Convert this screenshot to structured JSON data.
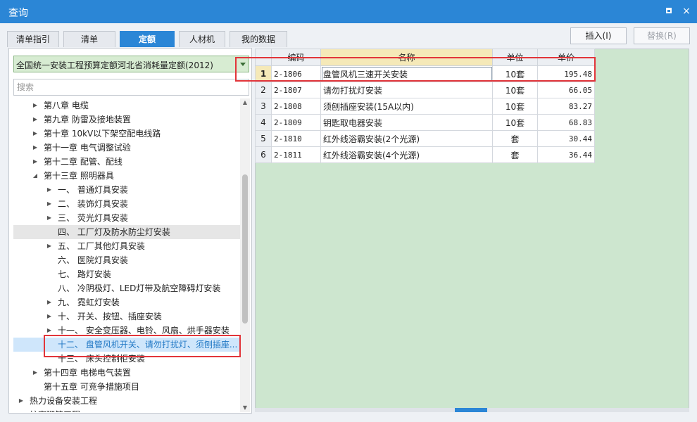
{
  "window": {
    "title": "查询",
    "maximize_label": "",
    "close_label": "×"
  },
  "tabs": [
    {
      "label": "清单指引",
      "active": false
    },
    {
      "label": "清单",
      "active": false
    },
    {
      "label": "定额",
      "active": true
    },
    {
      "label": "人材机",
      "active": false
    },
    {
      "label": "我的数据",
      "active": false
    }
  ],
  "toolbar": {
    "insert_label": "插入(I)",
    "replace_label": "替换(R)"
  },
  "quota_library": {
    "selected": "全国统一安装工程预算定额河北省消耗量定额(2012)"
  },
  "search": {
    "placeholder": "搜索",
    "value": ""
  },
  "tree": [
    {
      "label": "第八章 电缆",
      "toggle": "▶",
      "level": 1
    },
    {
      "label": "第九章 防雷及接地装置",
      "toggle": "▶",
      "level": 1
    },
    {
      "label": "第十章 10kV以下架空配电线路",
      "toggle": "▶",
      "level": 1
    },
    {
      "label": "第十一章 电气调整试验",
      "toggle": "▶",
      "level": 1
    },
    {
      "label": "第十二章 配管、配线",
      "toggle": "▶",
      "level": 1
    },
    {
      "label": "第十三章 照明器具",
      "toggle": "◢",
      "level": 1
    },
    {
      "label": "一、 普通灯具安装",
      "toggle": "▶",
      "level": 2
    },
    {
      "label": "二、 装饰灯具安装",
      "toggle": "▶",
      "level": 2
    },
    {
      "label": "三、 荧光灯具安装",
      "toggle": "▶",
      "level": 2
    },
    {
      "label": "四、 工厂灯及防水防尘灯安装",
      "toggle": "",
      "level": 2,
      "state": "hover"
    },
    {
      "label": "五、 工厂其他灯具安装",
      "toggle": "▶",
      "level": 2
    },
    {
      "label": "六、 医院灯具安装",
      "toggle": "",
      "level": 2
    },
    {
      "label": "七、 路灯安装",
      "toggle": "",
      "level": 2
    },
    {
      "label": "八、 冷阴极灯、LED灯带及航空障碍灯安装",
      "toggle": "",
      "level": 2
    },
    {
      "label": "九、 霓虹灯安装",
      "toggle": "▶",
      "level": 2
    },
    {
      "label": "十、 开关、按钮、插座安装",
      "toggle": "▶",
      "level": 2
    },
    {
      "label": "十一、 安全变压器、电铃、风扇、烘手器安装",
      "toggle": "▶",
      "level": 2
    },
    {
      "label": "十二、 盘管风机开关、请勿打扰灯、须刨插座...",
      "toggle": "",
      "level": 2,
      "state": "selected"
    },
    {
      "label": "十三、 床头控制柜安装",
      "toggle": "",
      "level": 2
    },
    {
      "label": "第十四章 电梯电气装置",
      "toggle": "▶",
      "level": 1
    },
    {
      "label": "第十五章 可竞争措施项目",
      "toggle": "",
      "level": 1
    },
    {
      "label": "热力设备安装工程",
      "toggle": "▶",
      "level": 0
    },
    {
      "label": "炉窑砌筑工程",
      "toggle": "",
      "level": 0
    }
  ],
  "table": {
    "columns": [
      "编码",
      "名称",
      "单位",
      "单价"
    ],
    "rows": [
      {
        "no": "1",
        "code": "2-1806",
        "name": "盘管风机三速开关安装",
        "unit": "10套",
        "price": "195.48"
      },
      {
        "no": "2",
        "code": "2-1807",
        "name": "请勿打扰灯安装",
        "unit": "10套",
        "price": "66.05"
      },
      {
        "no": "3",
        "code": "2-1808",
        "name": "须刨插座安装(15A以内)",
        "unit": "10套",
        "price": "83.27"
      },
      {
        "no": "4",
        "code": "2-1809",
        "name": "钥匙取电器安装",
        "unit": "10套",
        "price": "68.83"
      },
      {
        "no": "5",
        "code": "2-1810",
        "name": "红外线浴霸安装(2个光源)",
        "unit": "套",
        "price": "30.44"
      },
      {
        "no": "6",
        "code": "2-1811",
        "name": "红外线浴霸安装(4个光源)",
        "unit": "套",
        "price": "36.44"
      }
    ]
  },
  "hscroll": {
    "grip_glyph": "▲"
  },
  "colors": {
    "accent": "#2b86d6",
    "grid_bg": "#cde6cf",
    "highlight": "#e2353a"
  }
}
